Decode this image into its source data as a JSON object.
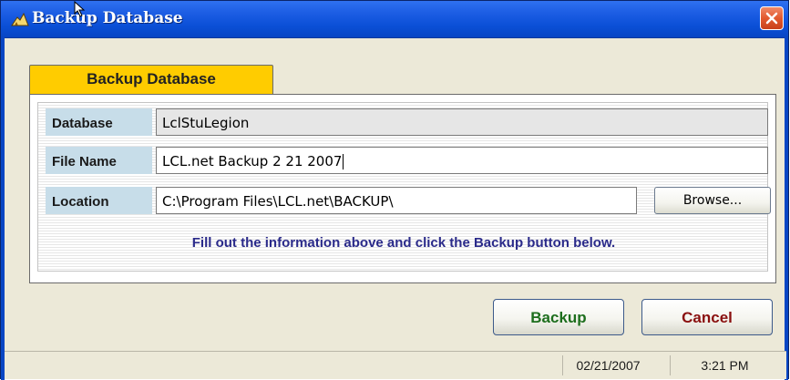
{
  "window": {
    "title": "Backup Database",
    "close_icon": "close-icon",
    "app_icon": "app-icon"
  },
  "tab": {
    "label": "Backup Database"
  },
  "fields": {
    "database": {
      "label": "Database",
      "value": "LclStuLegion"
    },
    "file_name": {
      "label": "File Name",
      "value": "LCL.net Backup 2 21 2007"
    },
    "location": {
      "label": "Location",
      "value": "C:\\Program Files\\LCL.net\\BACKUP\\"
    }
  },
  "browse_button": {
    "label": "Browse..."
  },
  "info": {
    "text": "Fill out the information above and click the Backup button below."
  },
  "buttons": {
    "backup": "Backup",
    "cancel": "Cancel"
  },
  "status": {
    "date": "02/21/2007",
    "time": "3:21 PM"
  },
  "colors": {
    "tab": "#ffcc00",
    "label_bg": "#c7dde9",
    "info_text": "#2a2a8a",
    "backup_text": "#1d6e1d",
    "cancel_text": "#8a1010"
  }
}
